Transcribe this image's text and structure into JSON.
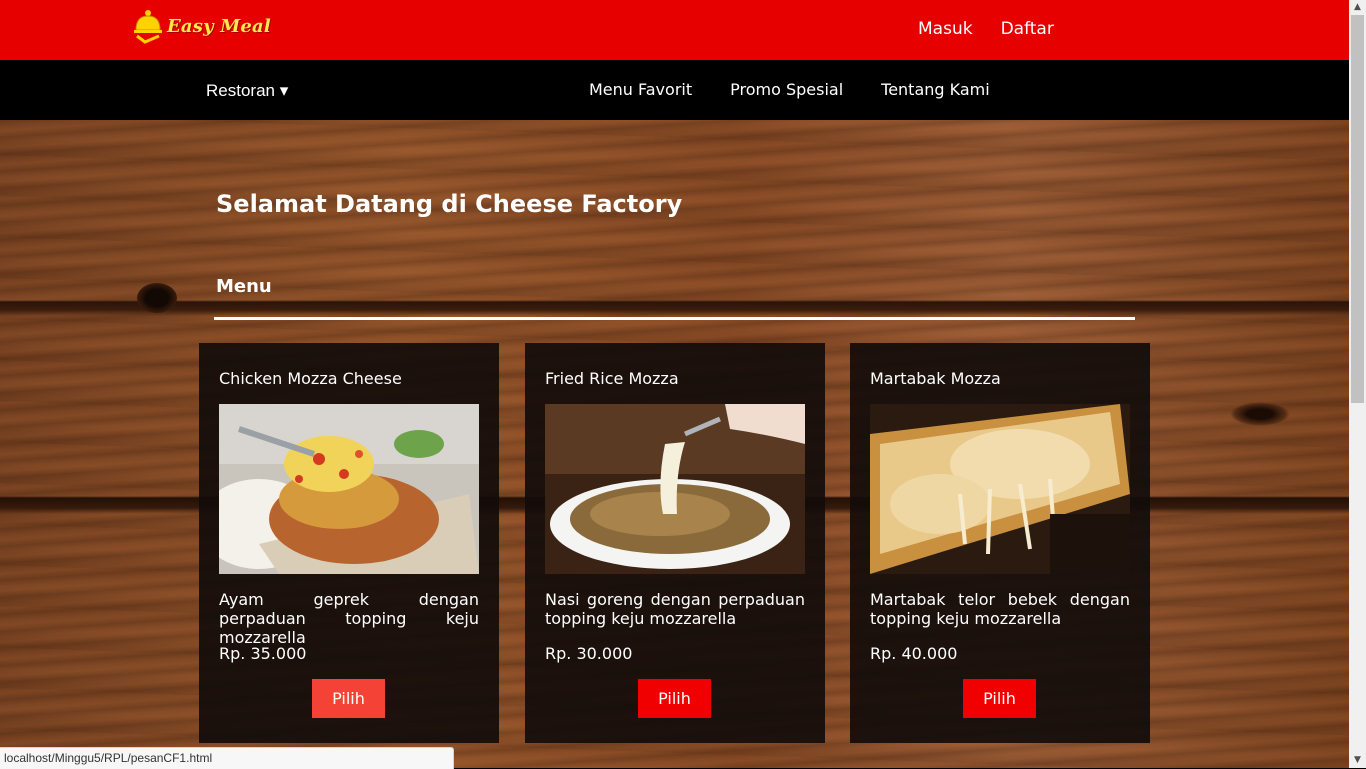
{
  "header": {
    "brand": "Easy Meal",
    "links": [
      "Masuk",
      "Daftar"
    ]
  },
  "nav": {
    "dropdown_label": "Restoran",
    "dropdown_caret": "▾",
    "links": [
      "Menu Favorit",
      "Promo Spesial",
      "Tentang Kami"
    ]
  },
  "main": {
    "welcome": "Selamat Datang di Cheese Factory",
    "section_title": "Menu",
    "cards": [
      {
        "title": "Chicken Mozza Cheese",
        "description": "Ayam geprek dengan perpaduan topping keju mozzarella",
        "price": "Rp. 35.000",
        "button": "Pilih"
      },
      {
        "title": "Fried Rice Mozza",
        "description": "Nasi goreng dengan perpaduan topping keju mozzarella",
        "price": "Rp. 30.000",
        "button": "Pilih"
      },
      {
        "title": "Martabak Mozza",
        "description": "Martabak telor bebek dengan topping keju mozzarella",
        "price": "Rp. 40.000",
        "button": "Pilih"
      }
    ]
  },
  "status_bar": {
    "url": "localhost/Minggu5/RPL/pesanCF1.html"
  },
  "colors": {
    "header_red": "#e60000",
    "button_red": "#f00000",
    "button_hover": "#f44336",
    "nav_black": "#000000",
    "logo_yellow": "#ffe94d"
  }
}
